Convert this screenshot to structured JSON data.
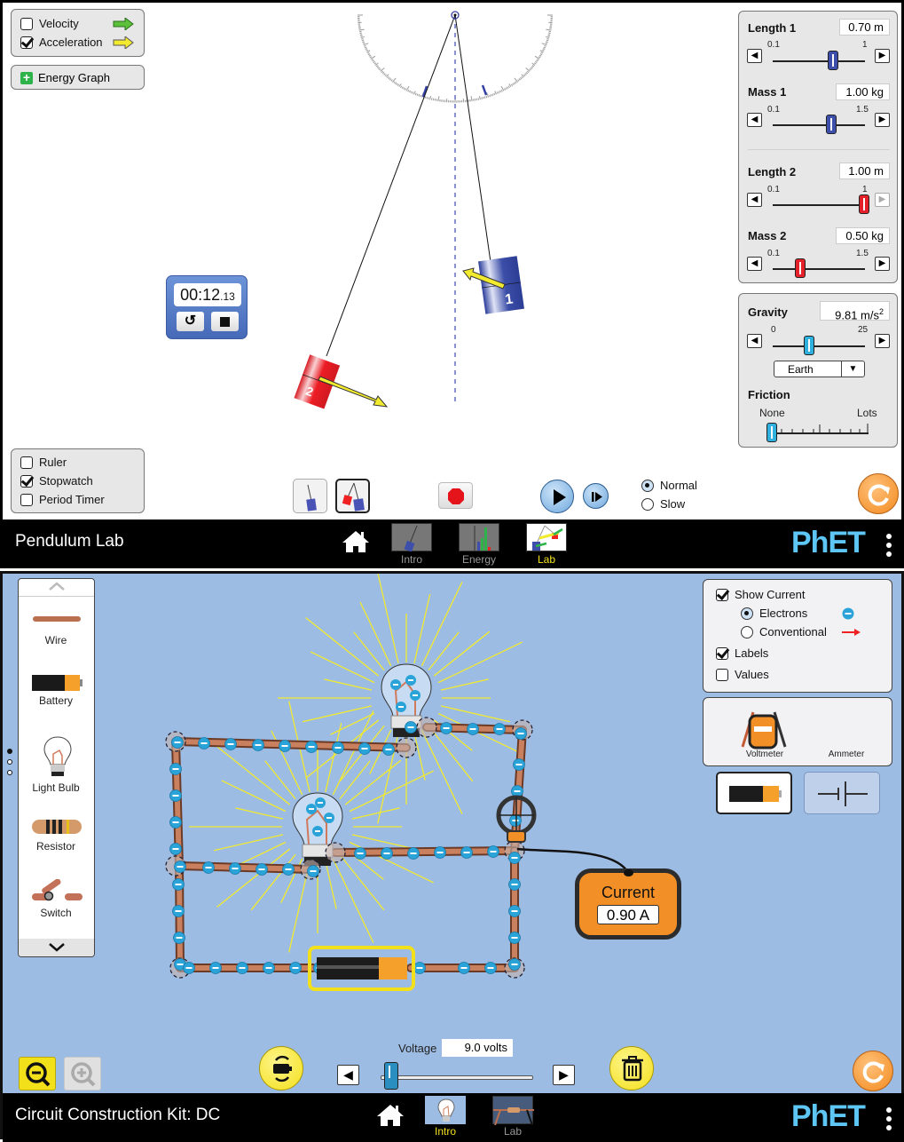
{
  "pendulum_lab": {
    "title": "Pendulum Lab",
    "vectors_panel": {
      "items": [
        {
          "label": "Velocity",
          "checked": false,
          "arrow_color": "#5cc03a"
        },
        {
          "label": "Acceleration",
          "checked": true,
          "arrow_color": "#f2ea2e"
        }
      ]
    },
    "energy_graph_label": "Energy Graph",
    "tools_panel": {
      "items": [
        {
          "label": "Ruler",
          "checked": false
        },
        {
          "label": "Stopwatch",
          "checked": true
        },
        {
          "label": "Period Timer",
          "checked": false
        }
      ]
    },
    "stopwatch": {
      "time_main": "00:12",
      "time_fraction": ".13"
    },
    "pendulum_labels": {
      "one": "1",
      "two": "2"
    },
    "controls": {
      "length1": {
        "label": "Length 1",
        "value": "0.70 m",
        "min": "0.1",
        "max": "1",
        "fraction": 0.667
      },
      "mass1": {
        "label": "Mass 1",
        "value": "1.00 kg",
        "min": "0.1",
        "max": "1.5",
        "fraction": 0.643
      },
      "length2": {
        "label": "Length 2",
        "value": "1.00 m",
        "min": "0.1",
        "max": "1",
        "fraction": 1.0
      },
      "mass2": {
        "label": "Mass 2",
        "value": "0.50 kg",
        "min": "0.1",
        "max": "1.5",
        "fraction": 0.286
      }
    },
    "gravity": {
      "label": "Gravity",
      "value": "9.81 m/s",
      "value_sup": "2",
      "min": "0",
      "max": "25",
      "fraction": 0.392,
      "preset": "Earth"
    },
    "friction": {
      "label": "Friction",
      "min_label": "None",
      "max_label": "Lots",
      "fraction": 0.0
    },
    "speed": {
      "options": [
        {
          "label": "Normal",
          "selected": true
        },
        {
          "label": "Slow",
          "selected": false
        }
      ]
    },
    "nav": {
      "screens": [
        {
          "label": "Intro",
          "active": false
        },
        {
          "label": "Energy",
          "active": false
        },
        {
          "label": "Lab",
          "active": true
        }
      ]
    },
    "brand": "PhET"
  },
  "cck": {
    "title": "Circuit Construction Kit: DC",
    "toolbox": {
      "items": [
        {
          "label": "Wire"
        },
        {
          "label": "Battery"
        },
        {
          "label": "Light Bulb"
        },
        {
          "label": "Resistor"
        },
        {
          "label": "Switch"
        }
      ],
      "page_dots": [
        true,
        false,
        false
      ]
    },
    "view_panel": {
      "show_current": {
        "label": "Show Current",
        "checked": true
      },
      "current_type": [
        {
          "label": "Electrons",
          "selected": true
        },
        {
          "label": "Conventional",
          "selected": false
        }
      ],
      "labels": {
        "label": "Labels",
        "checked": true
      },
      "values": {
        "label": "Values",
        "checked": false
      }
    },
    "meters": {
      "voltmeter": "Voltmeter",
      "ammeter": "Ammeter",
      "voltmeter_display": "Voltage"
    },
    "ammeter_readout": {
      "title": "Current",
      "value": "0.90 A"
    },
    "voltage": {
      "label": "Voltage",
      "value": "9.0 volts",
      "fraction": 0.05
    },
    "nav": {
      "screens": [
        {
          "label": "Intro",
          "active": true
        },
        {
          "label": "Lab",
          "active": false
        }
      ]
    },
    "brand": "PhET",
    "colors": {
      "background": "#9dbce3",
      "wire": "#b9704f",
      "electron": "#2aa3d8",
      "highlight": "#f2e01b",
      "reset": "#f29226"
    }
  }
}
